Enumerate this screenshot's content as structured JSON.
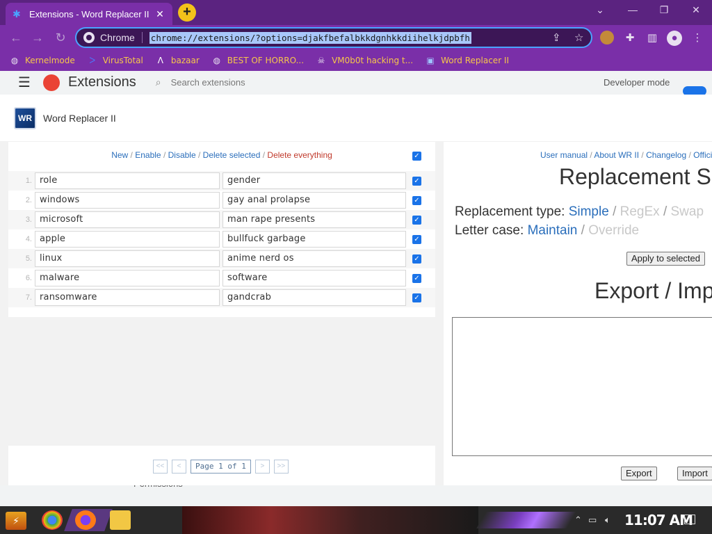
{
  "browser": {
    "tab_title": "Extensions - Word Replacer II",
    "tab_close": "✕",
    "new_tab": "+",
    "window_controls": [
      "⌄",
      "—",
      "❐",
      "✕"
    ],
    "omnibox_chip": "Chrome",
    "url": "chrome://extensions/?options=djakfbefalbkkdgnhkkdiihelkjdpbfh",
    "bookmarks": [
      {
        "label": "Kernelmode",
        "icon": "globe-icon"
      },
      {
        "label": "VirusTotal",
        "icon": "virustotal-icon"
      },
      {
        "label": "bazaar",
        "icon": "bazaar-icon"
      },
      {
        "label": "BEST OF HORRO...",
        "icon": "globe-icon"
      },
      {
        "label": "VM0b0t hacking t...",
        "icon": "skull-icon"
      },
      {
        "label": "Word Replacer II",
        "icon": "wr-icon"
      }
    ]
  },
  "behind_page": {
    "title": "Extensions",
    "search_placeholder": "Search extensions",
    "developer_mode": "Developer mode",
    "permissions": "Permissions"
  },
  "modal": {
    "logo_text": "WR",
    "title": "Word Replacer II",
    "actions": {
      "new": "New",
      "enable": "Enable",
      "disable": "Disable",
      "delete_selected": "Delete selected",
      "delete_everything": "Delete everything",
      "sep": " / "
    },
    "rows": [
      {
        "num": "1.",
        "from": "role",
        "to": "gender"
      },
      {
        "num": "2.",
        "from": "windows",
        "to": "gay anal prolapse"
      },
      {
        "num": "3.",
        "from": "microsoft",
        "to": "man rape presents"
      },
      {
        "num": "4.",
        "from": "apple",
        "to": "bullfuck garbage"
      },
      {
        "num": "5.",
        "from": "linux",
        "to": "anime nerd os"
      },
      {
        "num": "6.",
        "from": "malware",
        "to": "software"
      },
      {
        "num": "7.",
        "from": "ransomware",
        "to": "gandcrab"
      }
    ],
    "pager": {
      "first": "<<",
      "prev": "<",
      "label": "Page 1 of 1",
      "next": ">",
      "last": ">>"
    },
    "help_links": {
      "manual": "User manual",
      "about": "About WR II",
      "changelog": "Changelog",
      "official": "Offici"
    },
    "replacement_settings_title": "Replacement S",
    "replacement_type_label": "Replacement type:",
    "type_simple": "Simple",
    "type_regex": "RegEx",
    "type_swap": "Swap",
    "letter_case_label": "Letter case:",
    "case_maintain": "Maintain",
    "case_override": "Override",
    "apply_button": "Apply to selected",
    "export_import_title": "Export / Imp",
    "export_button": "Export",
    "import_button": "Import"
  },
  "taskbar": {
    "clock": "11:07 AM"
  }
}
